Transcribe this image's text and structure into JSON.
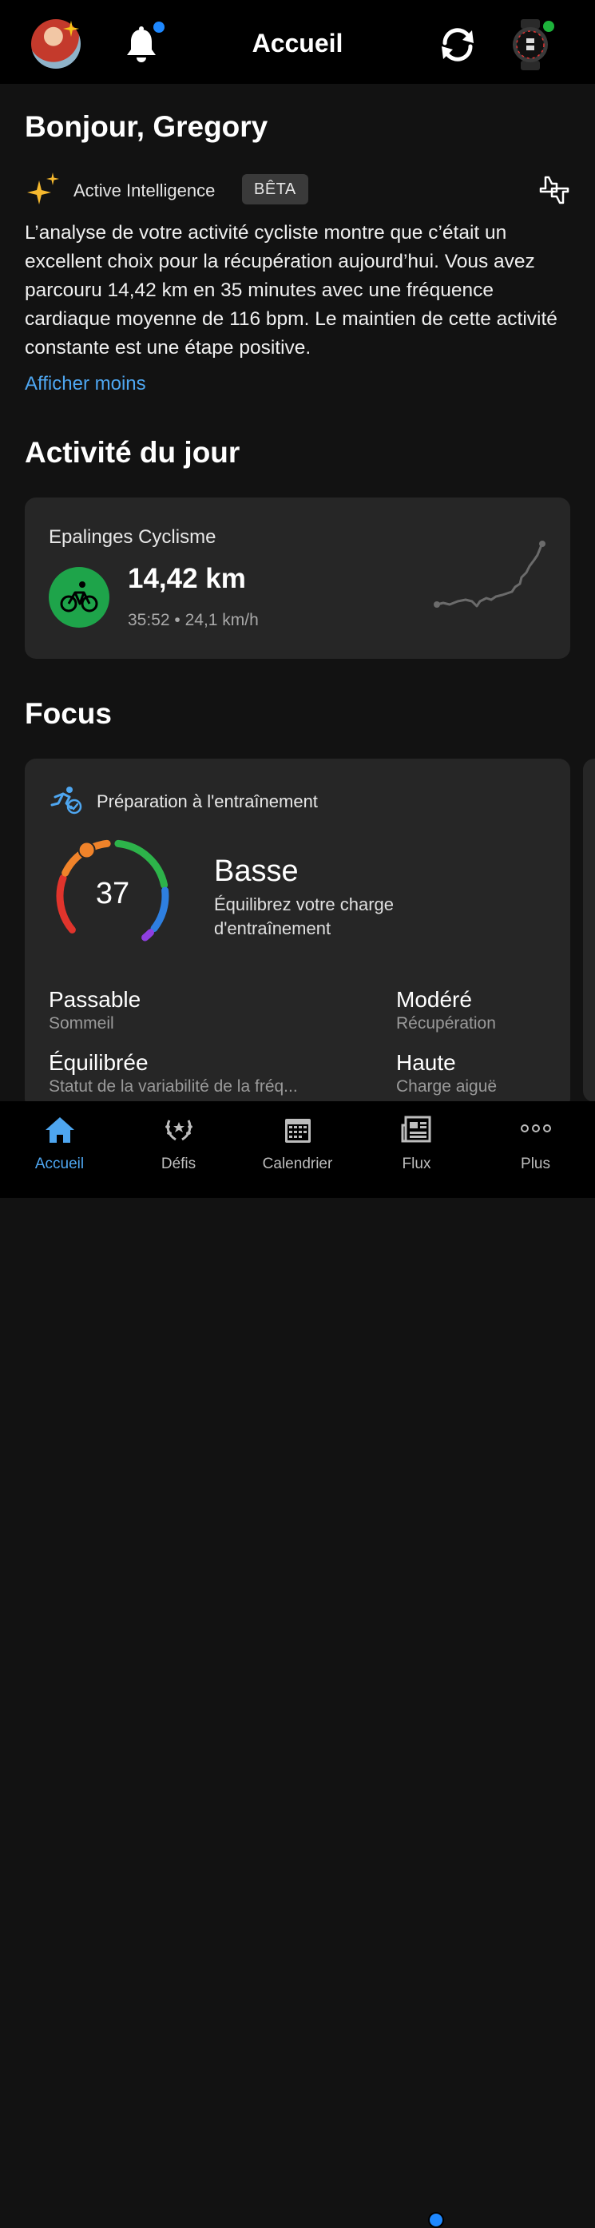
{
  "header": {
    "title": "Accueil"
  },
  "greeting": "Bonjour, Gregory",
  "active_intelligence": {
    "label": "Active Intelligence",
    "badge": "BÊTA",
    "text": "L’analyse de votre activité cycliste montre que c’était un excellent choix pour la récupération aujourd’hui. Vous avez parcouru 14,42 km en 35 minutes avec une fréquence cardiaque moyenne de 116 bpm. Le maintien de cette activité constante est une étape positive.",
    "toggle_link": "Afficher moins"
  },
  "activity_section": {
    "title": "Activité du jour",
    "activity": {
      "name": "Epalinges Cyclisme",
      "distance": "14,42 km",
      "duration": "35:52",
      "speed": "24,1 km/h"
    }
  },
  "focus_section": {
    "title": "Focus",
    "card": {
      "title": "Préparation à l'entraînement",
      "score": "37",
      "score_numeric": 37,
      "status": "Basse",
      "description": "Équilibrez votre charge d'entraînement",
      "metrics": [
        {
          "value": "Passable",
          "label": "Sommeil"
        },
        {
          "value": "Modéré",
          "label": "Récupération"
        },
        {
          "value": "Équilibrée",
          "label": "Statut de la variabilité de la fréq..."
        },
        {
          "value": "Haute",
          "label": "Charge aiguë"
        }
      ]
    }
  },
  "bottom_nav": [
    {
      "label": "Accueil",
      "icon": "home-icon",
      "active": true
    },
    {
      "label": "Défis",
      "icon": "laurel-icon",
      "active": false
    },
    {
      "label": "Calendrier",
      "icon": "calendar-icon",
      "active": false
    },
    {
      "label": "Flux",
      "icon": "news-icon",
      "active": false,
      "badge": true
    },
    {
      "label": "Plus",
      "icon": "more-icon",
      "active": false
    }
  ],
  "colors": {
    "accent_blue": "#4ea6f0",
    "notification_dot": "#1e88ff",
    "connected_dot": "#1db33b",
    "activity_green": "#1ea44a"
  }
}
